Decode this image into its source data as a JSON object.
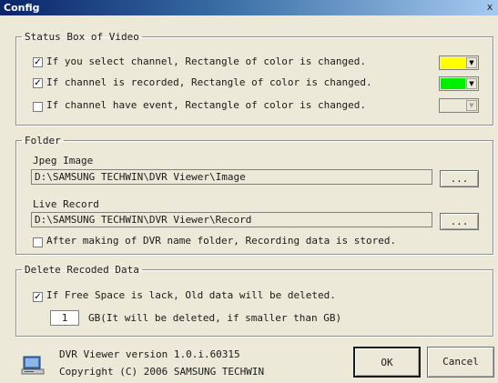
{
  "window": {
    "title": "Config",
    "close_glyph": "x"
  },
  "status_box": {
    "legend": "Status Box of Video",
    "options": [
      {
        "label": "If you select channel, Rectangle of color is changed.",
        "checked": true,
        "check_glyph": "✓",
        "color": "#ffff00",
        "arrow": "▼"
      },
      {
        "label": "If channel is recorded, Rectangle of color is changed.",
        "checked": true,
        "check_glyph": "✓",
        "color": "#00ee00",
        "arrow": "▼"
      },
      {
        "label": "If channel have event, Rectangle of color is changed.",
        "checked": false,
        "check_glyph": "",
        "color": "#ece9d8",
        "arrow": "▼"
      }
    ]
  },
  "folder": {
    "legend": "Folder",
    "jpeg_label": "Jpeg Image",
    "jpeg_path": "D:\\SAMSUNG TECHWIN\\DVR Viewer\\Image",
    "jpeg_browse": "...",
    "live_label": "Live Record",
    "live_path": "D:\\SAMSUNG TECHWIN\\DVR Viewer\\Record",
    "live_browse": "...",
    "name_folder_label": "After making of DVR name folder, Recording data is stored.",
    "name_folder_checked": false
  },
  "delete_data": {
    "legend": "Delete Recoded Data",
    "free_space_label": "If Free Space is lack, Old data will be deleted.",
    "free_space_checked": true,
    "free_space_glyph": "✓",
    "gb_value": "1",
    "gb_label": "GB(It will be deleted, if smaller than GB)"
  },
  "footer": {
    "version": "DVR Viewer version 1.0.i.60315",
    "copyright": "Copyright (C) 2006 SAMSUNG TECHWIN",
    "ok": "OK",
    "cancel": "Cancel",
    "icon": "computer-icon"
  }
}
